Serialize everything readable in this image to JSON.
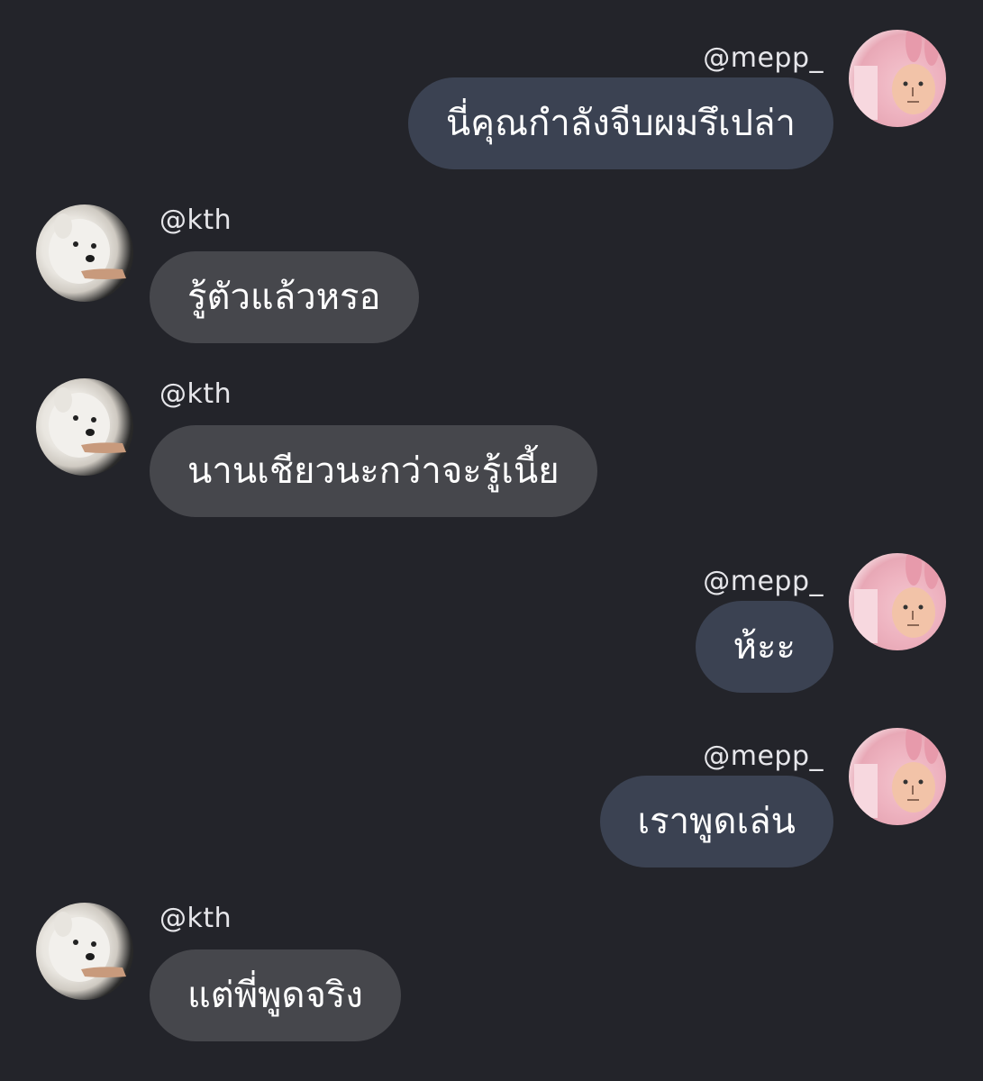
{
  "messages": [
    {
      "sender": "mine",
      "username": "@mepp_",
      "text": "นี่คุณกำลังจีบผมรึเปล่า",
      "avatar": "bunny-avatar"
    },
    {
      "sender": "theirs",
      "username": "@kth",
      "text": "รู้ตัวแล้วหรอ",
      "avatar": "dog-avatar"
    },
    {
      "sender": "theirs",
      "username": "@kth",
      "text": "นานเชียวนะกว่าจะรู้เนี้ย",
      "avatar": "dog-avatar"
    },
    {
      "sender": "mine",
      "username": "@mepp_",
      "text": "ห้ะะ",
      "avatar": "bunny-avatar"
    },
    {
      "sender": "mine",
      "username": "@mepp_",
      "text": "เราพูดเล่น",
      "avatar": "bunny-avatar"
    },
    {
      "sender": "theirs",
      "username": "@kth",
      "text": "แต่พี่พูดจริง",
      "avatar": "dog-avatar"
    }
  ],
  "colors": {
    "background": "#23242a",
    "bubble_mine": "#3b4252",
    "bubble_theirs": "#46474c",
    "text": "#ffffff",
    "username": "#e6e6ea"
  }
}
